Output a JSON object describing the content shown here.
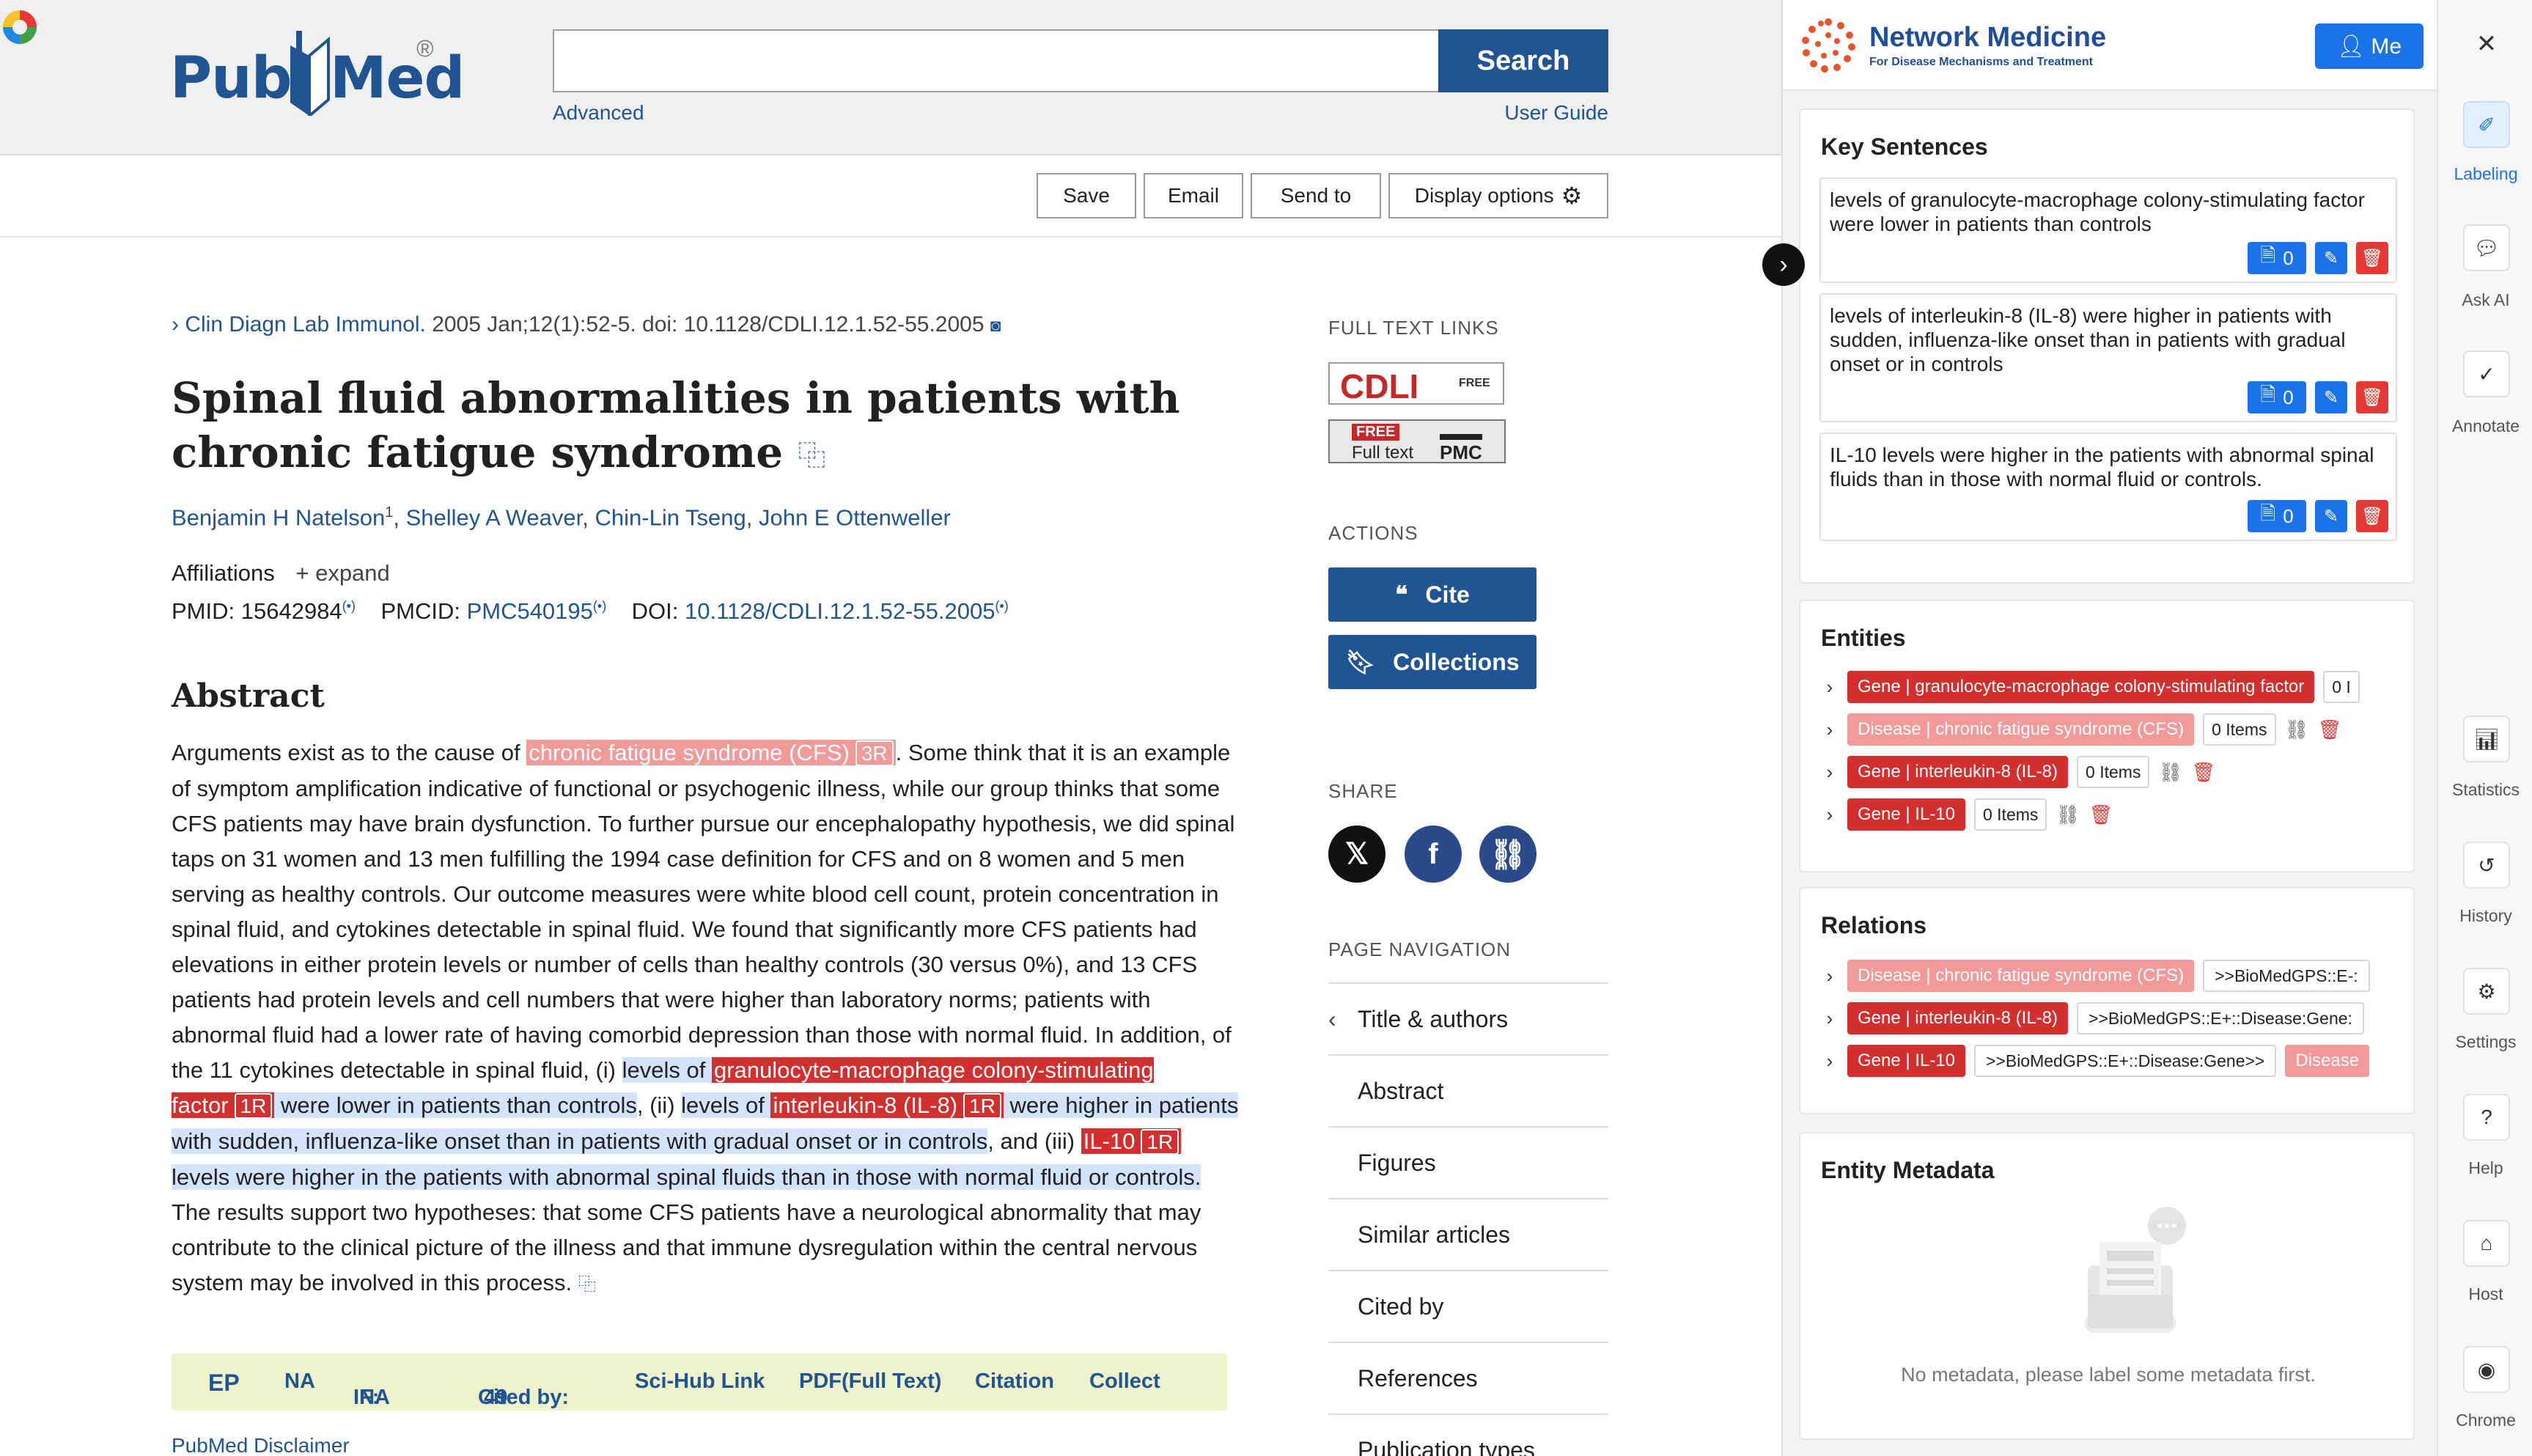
{
  "pubmed": {
    "logo": {
      "pub": "Pub",
      "med": "Med",
      "reg": "®"
    },
    "search": {
      "value": "",
      "button": "Search",
      "advanced": "Advanced",
      "user_guide": "User Guide"
    },
    "actions_bar": {
      "save": "Save",
      "email": "Email",
      "send_to": "Send to",
      "display_options": "Display options"
    },
    "article": {
      "journal": "Clin Diagn Lab Immunol.",
      "citation": "2005 Jan;12(1):52-5. doi: 10.1128/CDLI.12.1.52-55.2005",
      "title": "Spinal fluid abnormalities in patients with chronic fatigue syndrome",
      "authors": [
        "Benjamin H Natelson",
        "Shelley A Weaver",
        "Chin-Lin Tseng",
        "John E Ottenweller"
      ],
      "author1_sup": "1",
      "affiliations": "Affiliations",
      "expand": "expand",
      "pmid_label": "PMID:",
      "pmid": "15642984",
      "pmcid_label": "PMCID:",
      "pmcid": "PMC540195",
      "doi_label": "DOI:",
      "doi": "10.1128/CDLI.12.1.52-55.2005",
      "abstract_heading": "Abstract",
      "abstract": {
        "p1": "Arguments exist as to the cause of ",
        "e1": "chronic fatigue syndrome (CFS)",
        "e1_count": "3R",
        "p2": ". Some think that it is an example of symptom amplification indicative of functional or psychogenic illness, while our group thinks that some CFS patients may have brain dysfunction. To further pursue our encephalopathy hypothesis, we did spinal taps on 31 women and 13 men fulfilling the 1994 case definition for CFS and on 8 women and 5 men serving as healthy controls. Our outcome measures were white blood cell count, protein concentration in spinal fluid, and cytokines detectable in spinal fluid. We found that significantly more CFS patients had elevations in either protein levels or number of cells than healthy controls (30 versus 0%), and 13 CFS patients had protein levels and cell numbers that were higher than laboratory norms; patients with abnormal fluid had a lower rate of having comorbid depression than those with normal fluid. In addition, of the 11 cytokines detectable in spinal fluid, (i) ",
        "s1a": "levels of ",
        "e2": "granulocyte-macrophage colony-stimulating factor",
        "e2_count": "1R",
        "s1b": " were lower in patients than controls",
        "p3": ", (ii) ",
        "s2a": "levels of ",
        "e3": "interleukin-8 (IL-8)",
        "e3_count": "1R",
        "s2b": " were higher in patients with sudden, influenza-like onset than in patients with gradual onset or in controls",
        "p4": ", and (iii) ",
        "e4": "IL-10",
        "e4_count": "1R",
        "s3b": " levels were higher in the patients with abnormal spinal fluids than in those with normal fluid or controls.",
        "p5": " The results support two hypotheses: that some CFS patients have a neurological abnormality that may contribute to the clinical picture of the illness and that immune dysregulation within the central nervous system may be involved in this process."
      },
      "toolbar": {
        "ep": "EP",
        "na": "NA",
        "if": "IF:",
        "if_val": "NA",
        "cited": "Cited by:",
        "cited_val": "49",
        "scihub": "Sci-Hub Link",
        "pdf": "PDF(Full Text)",
        "citation": "Citation",
        "collect": "Collect"
      },
      "disclaimer": "PubMed Disclaimer"
    },
    "side": {
      "full_text_links": "FULL TEXT LINKS",
      "cdli": "CDLI",
      "cdli_free": "FREE",
      "pmc_free": "FREE",
      "pmc_full": "Full text",
      "pmc": "PMC",
      "actions": "ACTIONS",
      "cite": "Cite",
      "collections": "Collections",
      "share": "SHARE",
      "page_navigation": "PAGE NAVIGATION",
      "nav": [
        "Title & authors",
        "Abstract",
        "Figures",
        "Similar articles",
        "Cited by",
        "References",
        "Publication types"
      ]
    }
  },
  "network_medicine": {
    "title": "Network Medicine",
    "subtitle": "For Disease Mechanisms and Treatment",
    "me": "Me",
    "key_sentences": {
      "title": "Key Sentences",
      "items": [
        {
          "text": "levels of granulocyte-macrophage colony-stimulating factor were lower in patients than controls",
          "count": "0"
        },
        {
          "text": "levels of interleukin-8 (IL-8) were higher in patients with sudden, influenza-like onset than in patients with gradual onset or in controls",
          "count": "0"
        },
        {
          "text": "IL-10 levels were higher in the patients with abnormal spinal fluids than in those with normal fluid or controls.",
          "count": "0"
        }
      ]
    },
    "entities": {
      "title": "Entities",
      "items": [
        {
          "label": "Gene | granulocyte-macrophage colony-stimulating factor",
          "items": "0 I",
          "color": "red"
        },
        {
          "label": "Disease | chronic fatigue syndrome (CFS)",
          "items": "0 Items",
          "color": "pink"
        },
        {
          "label": "Gene | interleukin-8 (IL-8)",
          "items": "0 Items",
          "color": "red"
        },
        {
          "label": "Gene | IL-10",
          "items": "0 Items",
          "color": "red"
        }
      ]
    },
    "relations": {
      "title": "Relations",
      "items": [
        {
          "label": "Disease | chronic fatigue syndrome (CFS)",
          "rel": ">>BioMedGPS::E-:",
          "color": "pink"
        },
        {
          "label": "Gene | interleukin-8 (IL-8)",
          "rel": ">>BioMedGPS::E+::Disease:Gene:",
          "color": "red"
        },
        {
          "label": "Gene | IL-10",
          "rel": ">>BioMedGPS::E+::Disease:Gene>>",
          "tail": "Disease",
          "color": "red"
        }
      ]
    },
    "entity_metadata": {
      "title": "Entity Metadata",
      "empty": "No metadata, please label some metadata first."
    }
  },
  "rail": {
    "items": [
      "Labeling",
      "Ask AI",
      "Annotate",
      "Statistics",
      "History",
      "Settings",
      "Help",
      "Host",
      "Chrome"
    ],
    "active": "Labeling"
  },
  "colors": {
    "pubmed_blue": "#205493",
    "entity_red": "#d32f2f",
    "entity_pink": "#f29a9a",
    "selection": "#d3e3fb",
    "accent": "#1a73e8"
  }
}
